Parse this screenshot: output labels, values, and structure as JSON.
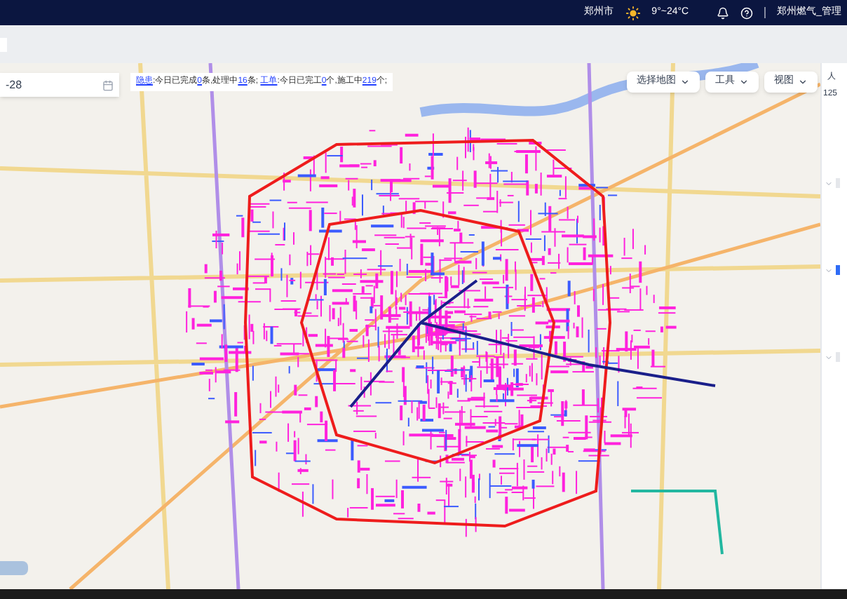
{
  "header": {
    "city": "郑州市",
    "temperature": "9°~24°C",
    "user": "郑州燃气_管理"
  },
  "date_field": {
    "value": "-28"
  },
  "notice": [
    {
      "text": "隐患",
      "highlight": true
    },
    {
      "text": ":今日已完成",
      "highlight": false
    },
    {
      "text": "0",
      "highlight": true
    },
    {
      "text": "条,处理中",
      "highlight": false
    },
    {
      "text": "16",
      "highlight": true
    },
    {
      "text": "条; ",
      "highlight": false
    },
    {
      "text": "工单",
      "highlight": true
    },
    {
      "text": ":今日已完工",
      "highlight": false
    },
    {
      "text": "0",
      "highlight": true
    },
    {
      "text": "个,施工中",
      "highlight": false
    },
    {
      "text": "219",
      "highlight": true
    },
    {
      "text": "个;",
      "highlight": false
    }
  ],
  "map_buttons": [
    {
      "label": "选择地图"
    },
    {
      "label": "工具"
    },
    {
      "label": "视图"
    }
  ],
  "side_panel": {
    "title": "人",
    "value": "125",
    "sections": [
      {
        "selected": false
      },
      {
        "selected": true
      },
      {
        "selected": false
      }
    ]
  }
}
